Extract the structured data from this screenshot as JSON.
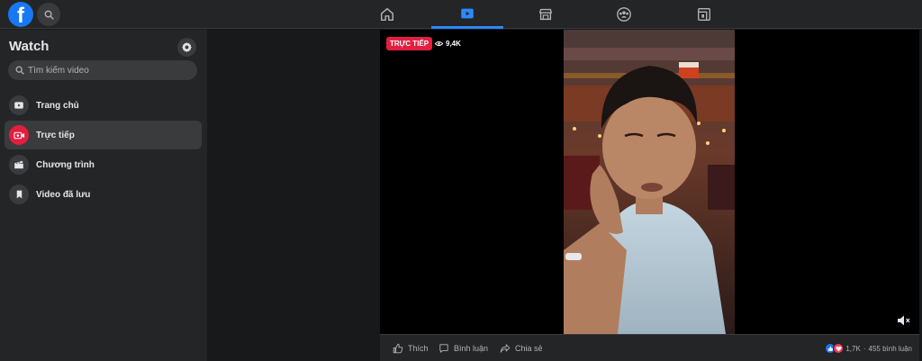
{
  "topbar": {
    "logo_letter": "f",
    "nav": [
      {
        "name": "home",
        "icon": "home-icon"
      },
      {
        "name": "watch",
        "icon": "watch-icon",
        "active": true
      },
      {
        "name": "marketplace",
        "icon": "marketplace-icon"
      },
      {
        "name": "groups",
        "icon": "groups-icon"
      },
      {
        "name": "gaming",
        "icon": "gaming-icon"
      }
    ],
    "accent": "#2d88ff"
  },
  "sidebar": {
    "title": "Watch",
    "search_placeholder": "Tìm kiếm video",
    "items": [
      {
        "label": "Trang chủ",
        "icon": "play-icon"
      },
      {
        "label": "Trực tiếp",
        "icon": "live-icon",
        "active": true
      },
      {
        "label": "Chương trình",
        "icon": "clapper-icon"
      },
      {
        "label": "Video đã lưu",
        "icon": "bookmark-icon"
      }
    ]
  },
  "video": {
    "live_label": "TRỰC TIẾP",
    "viewers": "9,4K",
    "live_color": "#e41e3f"
  },
  "actions": {
    "like": "Thích",
    "comment": "Bình luận",
    "share": "Chia sẻ",
    "reactions_count": "1,7K",
    "separator": "·",
    "comments_count": "455 bình luận"
  }
}
